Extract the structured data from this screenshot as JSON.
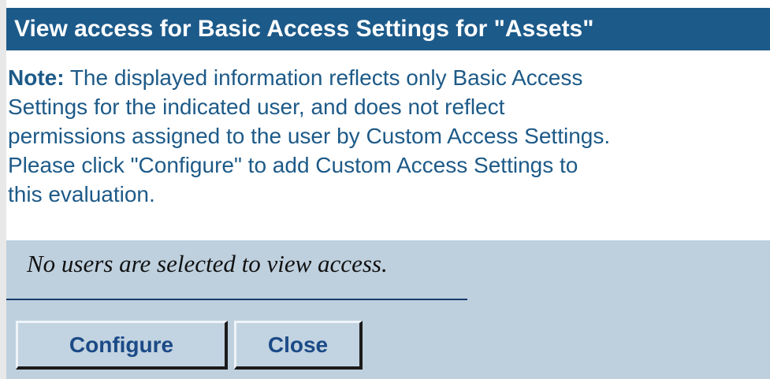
{
  "dialog": {
    "title": "View access for Basic Access Settings for \"Assets\""
  },
  "note": {
    "label": "Note:",
    "lines": [
      " The displayed information reflects only Basic Access",
      "Settings for the indicated user, and does not reflect",
      "permissions assigned to the user by Custom Access Settings.",
      "Please click \"Configure\" to add Custom Access Settings to",
      "this evaluation."
    ]
  },
  "message": {
    "empty_state": "No users are selected to view access."
  },
  "buttons": {
    "configure_label": "Configure",
    "close_label": "Close"
  },
  "colors": {
    "title_bar": "#1c5a8a",
    "note_text": "#1d5a88",
    "panel_background": "#bed0de",
    "button_background": "#c2d3e1",
    "button_text": "#1b4a86"
  }
}
